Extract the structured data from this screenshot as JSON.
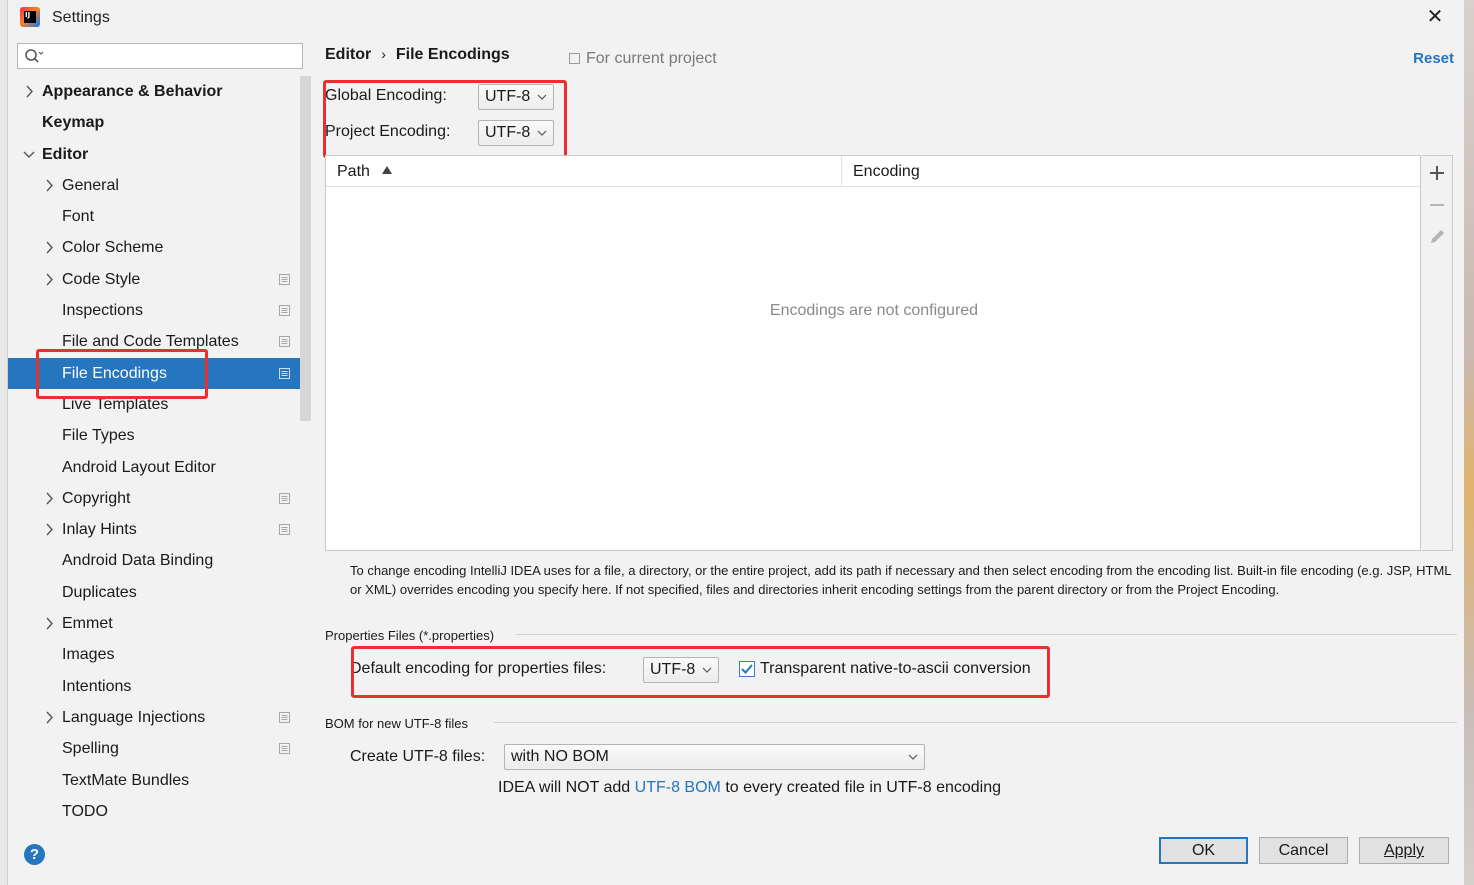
{
  "window": {
    "title": "Settings"
  },
  "search": {
    "placeholder": ""
  },
  "sidebar": {
    "items": [
      {
        "label": "Appearance & Behavior",
        "bold": true,
        "arrow": "right",
        "indent": 0,
        "project": false,
        "selected": false
      },
      {
        "label": "Keymap",
        "bold": true,
        "arrow": "none",
        "indent": 0,
        "project": false,
        "selected": false
      },
      {
        "label": "Editor",
        "bold": true,
        "arrow": "down",
        "indent": 0,
        "project": false,
        "selected": false
      },
      {
        "label": "General",
        "bold": false,
        "arrow": "right",
        "indent": 1,
        "project": false,
        "selected": false
      },
      {
        "label": "Font",
        "bold": false,
        "arrow": "none",
        "indent": 1,
        "project": false,
        "selected": false
      },
      {
        "label": "Color Scheme",
        "bold": false,
        "arrow": "right",
        "indent": 1,
        "project": false,
        "selected": false
      },
      {
        "label": "Code Style",
        "bold": false,
        "arrow": "right",
        "indent": 1,
        "project": true,
        "selected": false
      },
      {
        "label": "Inspections",
        "bold": false,
        "arrow": "none",
        "indent": 1,
        "project": true,
        "selected": false
      },
      {
        "label": "File and Code Templates",
        "bold": false,
        "arrow": "none",
        "indent": 1,
        "project": true,
        "selected": false
      },
      {
        "label": "File Encodings",
        "bold": false,
        "arrow": "none",
        "indent": 1,
        "project": true,
        "selected": true
      },
      {
        "label": "Live Templates",
        "bold": false,
        "arrow": "none",
        "indent": 1,
        "project": false,
        "selected": false
      },
      {
        "label": "File Types",
        "bold": false,
        "arrow": "none",
        "indent": 1,
        "project": false,
        "selected": false
      },
      {
        "label": "Android Layout Editor",
        "bold": false,
        "arrow": "none",
        "indent": 1,
        "project": false,
        "selected": false
      },
      {
        "label": "Copyright",
        "bold": false,
        "arrow": "right",
        "indent": 1,
        "project": true,
        "selected": false
      },
      {
        "label": "Inlay Hints",
        "bold": false,
        "arrow": "right",
        "indent": 1,
        "project": true,
        "selected": false
      },
      {
        "label": "Android Data Binding",
        "bold": false,
        "arrow": "none",
        "indent": 1,
        "project": false,
        "selected": false
      },
      {
        "label": "Duplicates",
        "bold": false,
        "arrow": "none",
        "indent": 1,
        "project": false,
        "selected": false
      },
      {
        "label": "Emmet",
        "bold": false,
        "arrow": "right",
        "indent": 1,
        "project": false,
        "selected": false
      },
      {
        "label": "Images",
        "bold": false,
        "arrow": "none",
        "indent": 1,
        "project": false,
        "selected": false
      },
      {
        "label": "Intentions",
        "bold": false,
        "arrow": "none",
        "indent": 1,
        "project": false,
        "selected": false
      },
      {
        "label": "Language Injections",
        "bold": false,
        "arrow": "right",
        "indent": 1,
        "project": true,
        "selected": false
      },
      {
        "label": "Spelling",
        "bold": false,
        "arrow": "none",
        "indent": 1,
        "project": true,
        "selected": false
      },
      {
        "label": "TextMate Bundles",
        "bold": false,
        "arrow": "none",
        "indent": 1,
        "project": false,
        "selected": false
      },
      {
        "label": "TODO",
        "bold": false,
        "arrow": "none",
        "indent": 1,
        "project": false,
        "selected": false
      }
    ]
  },
  "content": {
    "breadcrumb": {
      "parent": "Editor",
      "separator": "›",
      "current": "File Encodings"
    },
    "scope_label": "For current project",
    "reset_label": "Reset",
    "global_encoding": {
      "label": "Global Encoding:",
      "value": "UTF-8"
    },
    "project_encoding": {
      "label": "Project Encoding:",
      "value": "UTF-8"
    },
    "table": {
      "columns": [
        "Path",
        "Encoding"
      ],
      "empty_message": "Encodings are not configured",
      "sort_column": "Path",
      "sort_direction": "ascending"
    },
    "info_text": "To change encoding IntelliJ IDEA uses for a file, a directory, or the entire project, add its path if necessary and then select encoding from the encoding list. Built-in file encoding (e.g. JSP, HTML or XML) overrides encoding you specify here. If not specified, files and directories inherit encoding settings from the parent directory or from the Project Encoding.",
    "properties": {
      "group_title": "Properties Files (*.properties)",
      "default_label": "Default encoding for properties files:",
      "default_value": "UTF-8",
      "native_to_ascii_label": "Transparent native-to-ascii conversion",
      "native_to_ascii_checked": true
    },
    "bom": {
      "group_title": "BOM for new UTF-8 files",
      "create_label": "Create UTF-8 files:",
      "create_value": "with NO BOM",
      "note_prefix": "IDEA will NOT add",
      "note_link": "UTF-8 BOM",
      "note_suffix": "to every created file in UTF-8 encoding"
    }
  },
  "footer": {
    "help_label": "?",
    "ok_label": "OK",
    "cancel_label": "Cancel",
    "apply_label": "Apply"
  },
  "colors": {
    "accent": "#2675bf",
    "highlight_box": "#e8312f",
    "background": "#f2f2f2"
  }
}
